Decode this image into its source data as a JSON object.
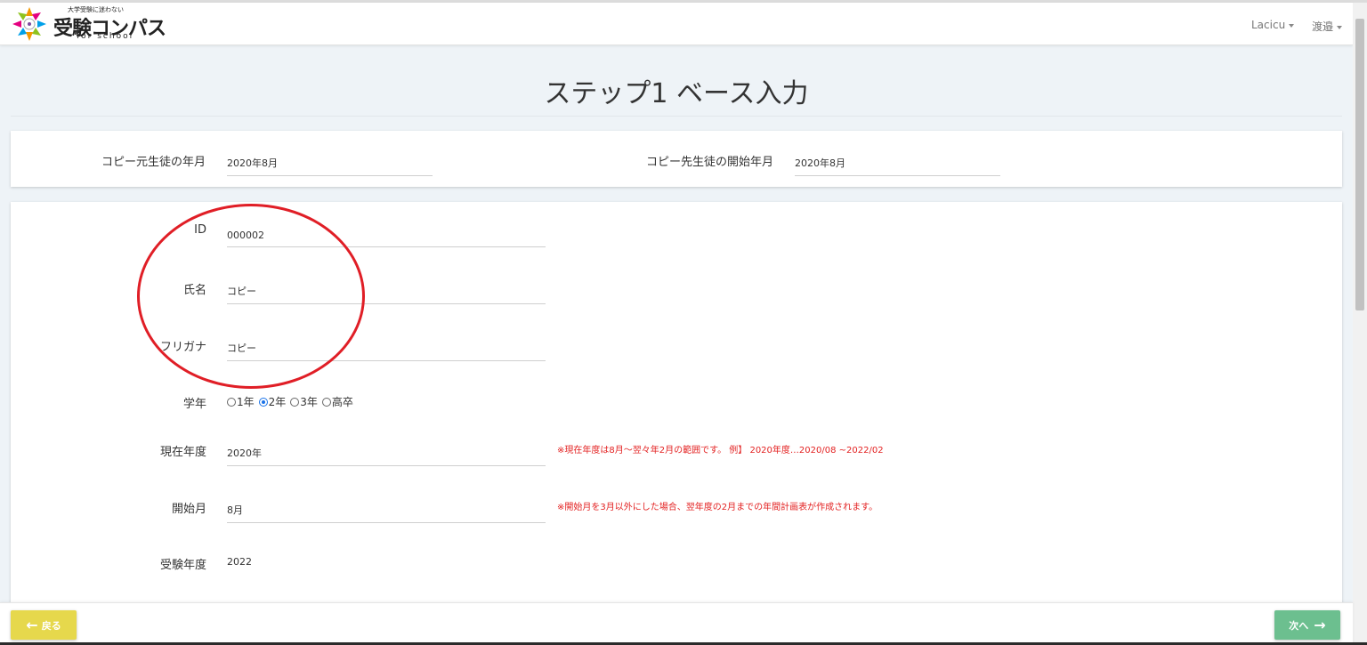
{
  "header": {
    "logo": {
      "tagline": "大学受験に迷わない",
      "title": "受験コンパス",
      "subtitle": "for school"
    },
    "user_menu": [
      {
        "label": "Lacicu"
      },
      {
        "label": "渡邉"
      }
    ]
  },
  "page": {
    "title": "ステップ1 ベース入力"
  },
  "copy_section": {
    "source_label": "コピー元生徒の年月",
    "source_value": "2020年8月",
    "dest_label": "コピー先生徒の開始年月",
    "dest_value": "2020年8月"
  },
  "form": {
    "id_label": "ID",
    "id_value": "000002",
    "name_label": "氏名",
    "name_value": "コピー",
    "furigana_label": "フリガナ",
    "furigana_value": "コピー",
    "grade_label": "学年",
    "grade_options": [
      "1年",
      "2年",
      "3年",
      "高卒"
    ],
    "grade_selected": "2年",
    "current_year_label": "現在年度",
    "current_year_value": "2020年",
    "current_year_note": "※現在年度は8月～翌々年2月の範囲です。 例】 2020年度…2020/08 ~2022/02",
    "start_month_label": "開始月",
    "start_month_value": "8月",
    "start_month_note": "※開始月を3月以外にした場合、翌年度の2月までの年間計画表が作成されます。",
    "exam_year_label": "受験年度",
    "exam_year_value": "2022"
  },
  "footer": {
    "back_label": "戻る",
    "next_label": "次へ"
  },
  "colors": {
    "annotation": "#e01e26",
    "note_red": "#e32222",
    "back_button": "#e6d84c",
    "next_button": "#6cbf8f",
    "radio_checked": "#1a73e8"
  }
}
